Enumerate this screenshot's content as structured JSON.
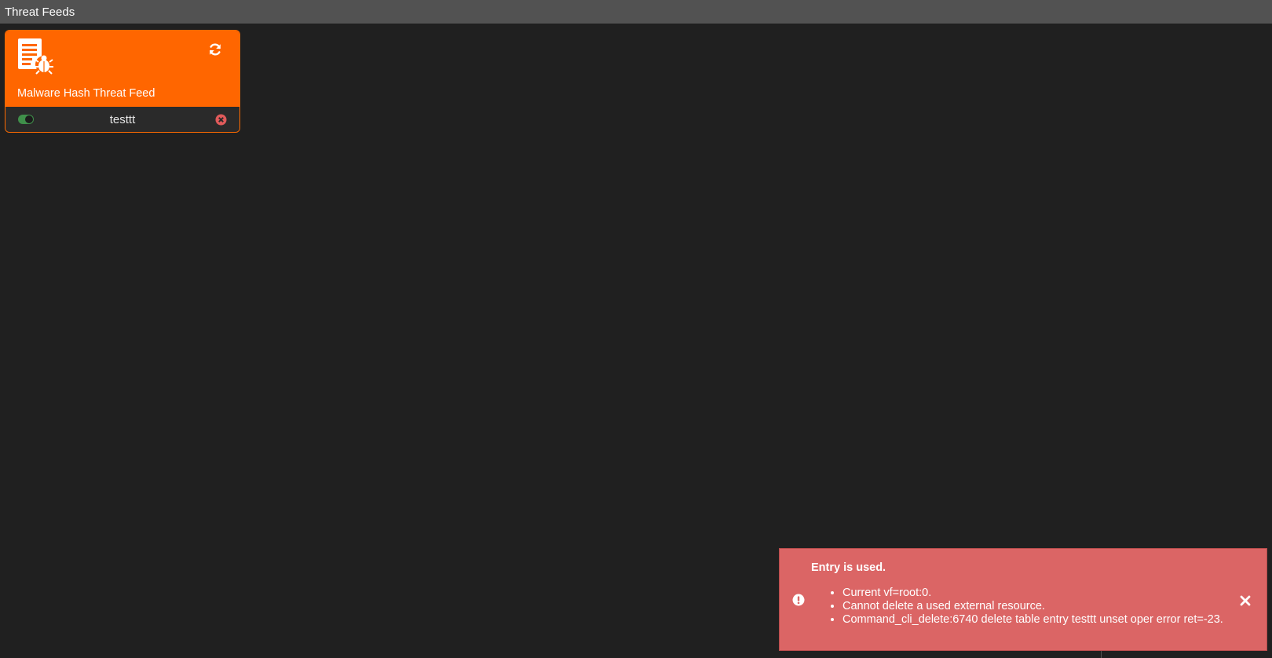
{
  "header": {
    "title": "Threat Feeds"
  },
  "card": {
    "title": "Malware Hash Threat Feed",
    "name": "testtt",
    "enabled": true,
    "icon": "malware-document-icon",
    "colors": {
      "header": "#ff6600",
      "toggle_on": "#3f8f4a",
      "delete": "#e05a5a"
    }
  },
  "toast": {
    "title": "Entry is used.",
    "messages": [
      "Current vf=root:0.",
      "Cannot delete a used external resource.",
      "Command_cli_delete:6740 delete table entry testtt unset oper error ret=-23."
    ],
    "color": "#db6565"
  }
}
